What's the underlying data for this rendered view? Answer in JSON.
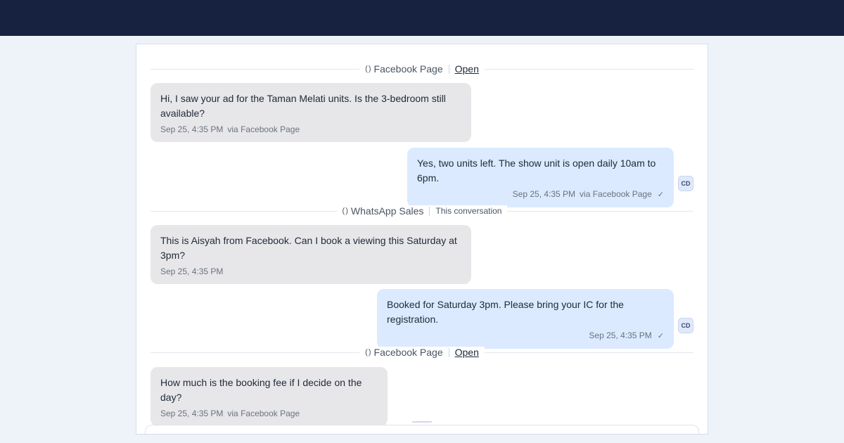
{
  "dividers": [
    {
      "channel": "Facebook Page",
      "action": "Open"
    },
    {
      "channel": "WhatsApp Sales",
      "note": "This conversation"
    },
    {
      "channel": "Facebook Page",
      "action": "Open"
    }
  ],
  "messages": [
    {
      "direction": "incoming",
      "text": "Hi, I saw your ad for the Taman Melati units. Is the 3-bedroom still available?",
      "time": "Sep 25, 4:35 PM",
      "via": "via Facebook Page"
    },
    {
      "direction": "outgoing",
      "text": "Yes, two units left. The show unit is open daily 10am to 6pm.",
      "time": "Sep 25, 4:35 PM",
      "via": "via Facebook Page",
      "status": "✓",
      "avatar": "CD"
    },
    {
      "direction": "incoming",
      "text": "This is Aisyah from Facebook. Can I book a viewing this Saturday at 3pm?",
      "time": "Sep 25, 4:35 PM"
    },
    {
      "direction": "outgoing",
      "text": "Booked for Saturday 3pm. Please bring your IC for the registration.",
      "time": "Sep 25, 4:35 PM",
      "status": "✓",
      "avatar": "CD"
    },
    {
      "direction": "incoming",
      "text": "How much is the booking fee if I decide on the day?",
      "time": "Sep 25, 4:35 PM",
      "via": "via Facebook Page"
    }
  ],
  "icons": {
    "channel": "channel-icon",
    "read": "check-icon"
  },
  "colors": {
    "topbar": "#162240",
    "incoming_bubble": "#e7e7ea",
    "outgoing_bubble": "#dbeafe",
    "background": "#eef2f9"
  }
}
